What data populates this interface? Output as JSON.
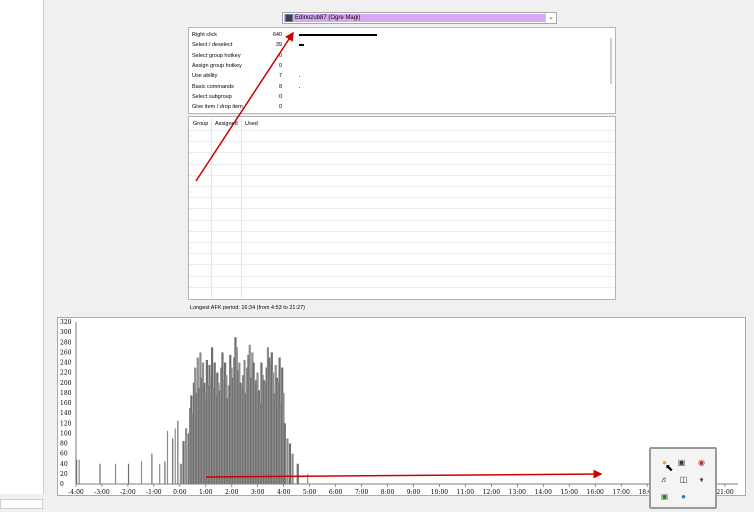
{
  "player_select": {
    "value": "Edinozub87 (Ogre Magi)",
    "dropdown_icon": "chevron-down-icon"
  },
  "actions": [
    {
      "label": "Right click",
      "value": "640",
      "ratio": 1.0
    },
    {
      "label": "Select / deselect",
      "value": "39",
      "ratio": 0.061
    },
    {
      "label": "Select group hotkey",
      "value": "0",
      "ratio": 0
    },
    {
      "label": "Assign group hotkey",
      "value": "0",
      "ratio": 0
    },
    {
      "label": "Use ability",
      "value": "7",
      "ratio": 0.011
    },
    {
      "label": "Basic commands",
      "value": "8",
      "ratio": 0.012
    },
    {
      "label": "Select subgroup",
      "value": "0",
      "ratio": 0
    },
    {
      "label": "Give item / drop item",
      "value": "0",
      "ratio": 0
    }
  ],
  "groups_table": {
    "headers": [
      "Group",
      "Assigned",
      "Used"
    ]
  },
  "afk": {
    "text": "Longest AFK period: 16:34 (from 4:53 to 21:27)"
  },
  "chart_data": {
    "type": "bar",
    "title": "",
    "xlabel": "",
    "ylabel": "",
    "ylim": [
      0,
      320
    ],
    "xlim": [
      -4,
      21.5
    ],
    "y_ticks": [
      "0",
      "20",
      "40",
      "60",
      "80",
      "100",
      "120",
      "140",
      "160",
      "180",
      "200",
      "220",
      "240",
      "260",
      "280",
      "300",
      "320"
    ],
    "x_ticks": [
      "-4:00",
      "-3:00",
      "-2:00",
      "-1:00",
      "0:00",
      "1:00",
      "2:00",
      "3:00",
      "4:00",
      "5:00",
      "6:00",
      "7:00",
      "8:00",
      "9:00",
      "10:00",
      "11:00",
      "12:00",
      "13:00",
      "14:00",
      "15:00",
      "16:00",
      "17:00",
      "18:00",
      "21:00"
    ],
    "x_tick_values": [
      -4,
      -3,
      -2,
      -1,
      0,
      1,
      2,
      3,
      4,
      5,
      6,
      7,
      8,
      9,
      10,
      11,
      12,
      13,
      14,
      15,
      16,
      17,
      18,
      21
    ],
    "series": [
      {
        "name": "",
        "x": [
          -4.0,
          -3.9,
          -3.1,
          -2.5,
          -2.0,
          -1.5,
          -1.1,
          -0.8,
          -0.6,
          -0.5,
          -0.3,
          -0.2,
          -0.1,
          0.0,
          0.1,
          0.2,
          0.3,
          0.35,
          0.4,
          0.45,
          0.5,
          0.55,
          0.6,
          0.65,
          0.7,
          0.75,
          0.8,
          0.85,
          0.9,
          0.95,
          1.0,
          1.05,
          1.1,
          1.15,
          1.2,
          1.25,
          1.3,
          1.35,
          1.4,
          1.45,
          1.5,
          1.55,
          1.6,
          1.65,
          1.7,
          1.75,
          1.8,
          1.85,
          1.9,
          1.95,
          2.0,
          2.05,
          2.1,
          2.15,
          2.2,
          2.25,
          2.3,
          2.35,
          2.4,
          2.45,
          2.5,
          2.55,
          2.6,
          2.65,
          2.7,
          2.75,
          2.8,
          2.85,
          2.9,
          2.95,
          3.0,
          3.05,
          3.1,
          3.15,
          3.2,
          3.25,
          3.3,
          3.35,
          3.4,
          3.45,
          3.5,
          3.55,
          3.6,
          3.65,
          3.7,
          3.75,
          3.8,
          3.85,
          3.9,
          3.95,
          4.0,
          4.1,
          4.2,
          4.3,
          4.5,
          4.9
        ],
        "values": [
          48,
          48,
          40,
          40,
          40,
          45,
          60,
          40,
          45,
          105,
          90,
          110,
          125,
          40,
          85,
          110,
          100,
          150,
          175,
          140,
          200,
          230,
          180,
          250,
          190,
          260,
          210,
          240,
          200,
          180,
          245,
          195,
          235,
          210,
          270,
          190,
          240,
          175,
          220,
          200,
          185,
          230,
          260,
          205,
          240,
          215,
          170,
          195,
          255,
          230,
          210,
          250,
          290,
          270,
          225,
          240,
          200,
          190,
          215,
          245,
          180,
          230,
          255,
          275,
          210,
          260,
          240,
          195,
          205,
          220,
          185,
          160,
          240,
          215,
          205,
          200,
          230,
          270,
          250,
          235,
          260,
          220,
          180,
          235,
          210,
          200,
          250,
          160,
          230,
          180,
          120,
          90,
          80,
          60,
          40,
          20
        ]
      }
    ]
  },
  "tray": {
    "icons": [
      "orange-app-icon",
      "nvidia-icon",
      "camera-icon",
      "speaker-icon",
      "network-icon",
      "shield-icon",
      "green-app-icon",
      "color-app-icon"
    ]
  }
}
